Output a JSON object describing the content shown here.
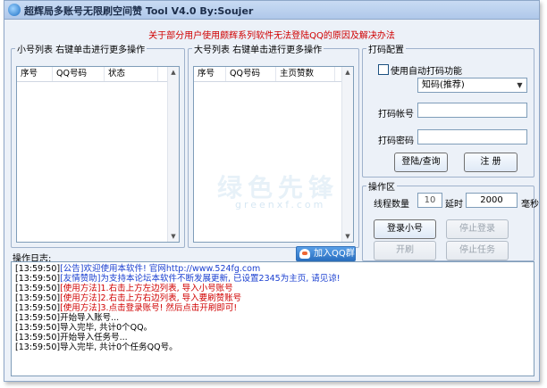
{
  "window": {
    "title": "超辉局多账号无限刷空间赞 Tool V4.0 By:Soujer"
  },
  "notice_link": "关于部分用户使用颇辉系列软件无法登陆QQ的原因及解决办法",
  "small_list": {
    "legend": "小号列表  右键单击进行更多操作",
    "columns": [
      "序号",
      "QQ号码",
      "状态"
    ]
  },
  "big_list": {
    "legend": "大号列表  右键单击进行更多操作",
    "columns": [
      "序号",
      "QQ号码",
      "主页赞数"
    ]
  },
  "captcha": {
    "legend": "打码配置",
    "auto_label": "使用自动打码功能",
    "auto_checked": false,
    "service_selected": "知码(推荐)",
    "account_label": "打码帐号",
    "account_value": "",
    "password_label": "打码密码",
    "password_value": "",
    "login_btn": "登陆/查询",
    "register_btn": "注  册"
  },
  "ops": {
    "legend": "操作区",
    "threads_label": "线程数量",
    "threads_value": "10",
    "delay_label": "延时",
    "delay_value": "2000",
    "delay_unit": "毫秒",
    "login_small_btn": "登录小号",
    "stop_login_btn": "停止登录",
    "start_btn": "开刷",
    "stop_task_btn": "停止任务"
  },
  "log": {
    "label": "操作日志:",
    "join_qq_group": "加入QQ群",
    "lines": [
      {
        "ts": "[13:59:50]",
        "text": "[公告]欢迎使用本软件! 官网http://www.524fg.com",
        "color": "#1a3fd0"
      },
      {
        "ts": "[13:59:50]",
        "text": "[友情赞助]为支持本论坛本软件不断发展更新, 已设置2345为主页, 请见谅!",
        "color": "#1a3fd0"
      },
      {
        "ts": "[13:59:50]",
        "text": "[使用方法]1.右击上方左边列表, 导入小号账号",
        "color": "#d00000"
      },
      {
        "ts": "[13:59:50]",
        "text": "[使用方法]2.右击上方右边列表, 导入要刷赞账号",
        "color": "#d00000"
      },
      {
        "ts": "[13:59:50]",
        "text": "[使用方法]3.点击登录账号! 然后点击开刷即可!",
        "color": "#d00000"
      },
      {
        "ts": "[13:59:50]",
        "text": "开始导入账号...",
        "color": "#000000"
      },
      {
        "ts": "[13:59:50]",
        "text": "导入完毕, 共计0个QQ。",
        "color": "#000000"
      },
      {
        "ts": "[13:59:50]",
        "text": "开始导入任务号...",
        "color": "#000000"
      },
      {
        "ts": "[13:59:50]",
        "text": "导入完毕, 共计0个任务QQ号。",
        "color": "#000000"
      }
    ]
  },
  "watermark": {
    "text": "绿色先锋",
    "sub": "greenxf.com"
  }
}
